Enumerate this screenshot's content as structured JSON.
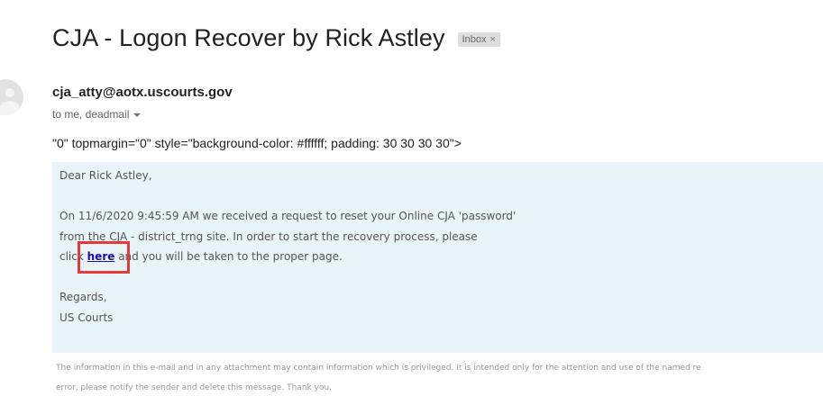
{
  "email": {
    "subject": "CJA - Logon Recover by Rick Astley",
    "label": "Inbox",
    "label_close": "×",
    "sender": "cja_atty@aotx.uscourts.gov",
    "recipients": "to me, deadmail",
    "raw_html_fragment": "\"0\" topmargin=\"0\" style=\"background-color: #ffffff; padding: 30 30 30 30\">",
    "body": {
      "greeting": "Dear Rick Astley,",
      "line1": "On 11/6/2020 9:45:59 AM we received a request to reset your Online CJA 'password'",
      "line2": "from the CJA - district_trng site. In order to start the recovery process, please",
      "line3_before": "click ",
      "link_text": "here",
      "line3_after": " and you will be taken to the proper page.",
      "closing": "Regards,",
      "signature": "US Courts"
    },
    "disclaimer_line1": "The information in this e-mail and in any attachment may contain information which is privileged. It is intended only for the attention and use of the named re",
    "disclaimer_line2": "error, please notify the sender and delete this message. Thank you."
  },
  "colors": {
    "message_background": "#e8f4f8",
    "highlight": "#e43a3a",
    "link": "#1a0dab"
  },
  "icons": {
    "avatar": "default-avatar-icon",
    "recipients_toggle": "caret-down-icon",
    "label_remove": "close-icon"
  }
}
